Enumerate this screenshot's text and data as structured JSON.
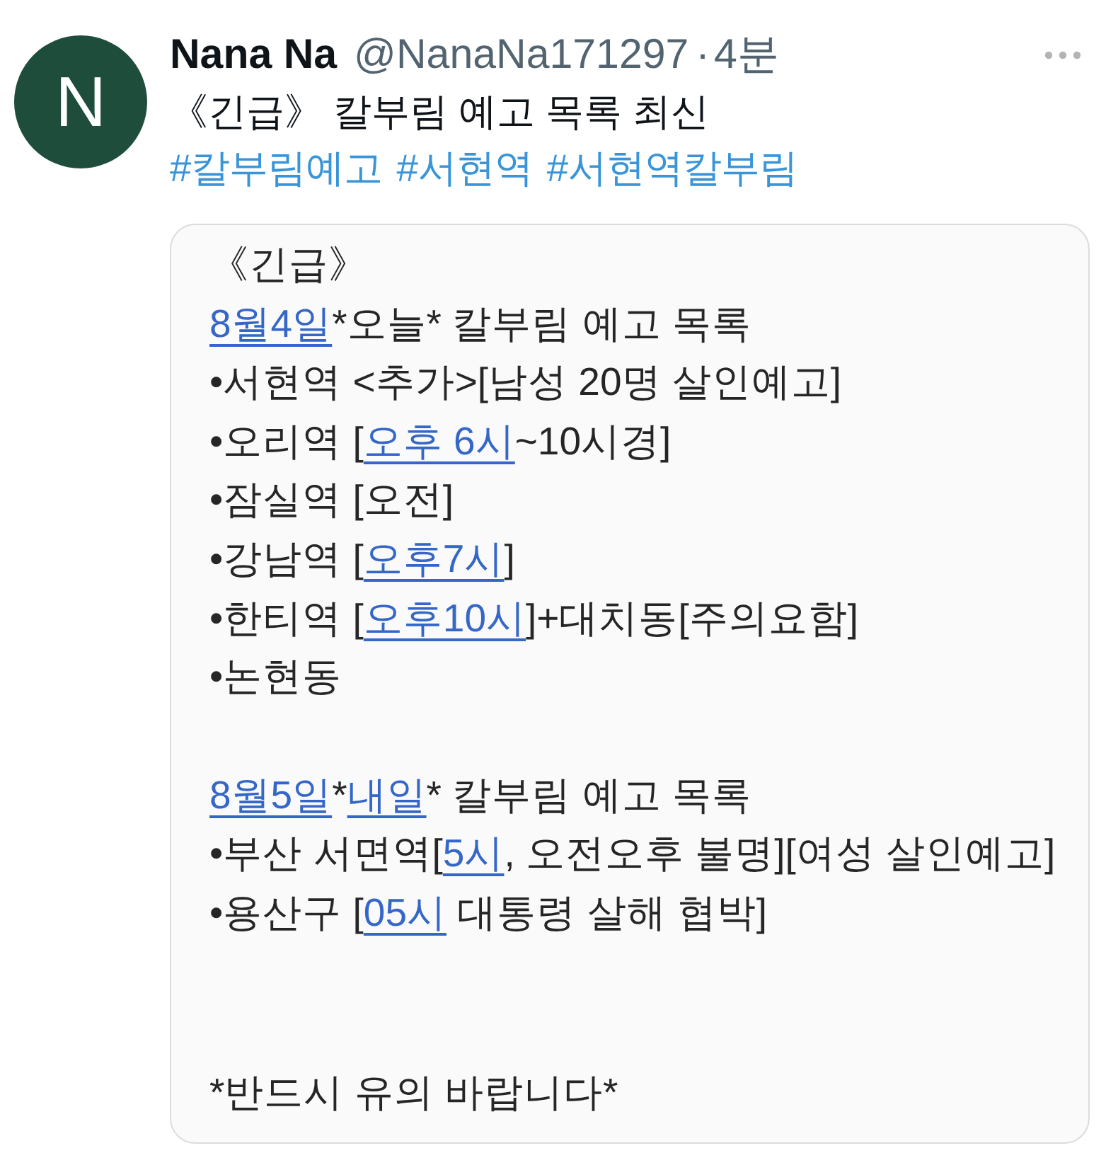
{
  "tweet": {
    "author": {
      "avatar_letter": "N",
      "name": "Nana Na",
      "handle": "@NanaNa171297",
      "separator": "·",
      "time": "4분"
    },
    "text": "《긴급》 칼부림 예고 목록 최신",
    "hashtags": [
      "#칼부림예고",
      "#서현역",
      "#서현역칼부림"
    ]
  },
  "note": {
    "sections": [
      {
        "lines": [
          [
            {
              "text": "《긴급》",
              "link": false
            }
          ],
          [
            {
              "text": "8월4일",
              "link": true
            },
            {
              "text": "*오늘* 칼부림 예고 목록",
              "link": false
            }
          ],
          [
            {
              "text": "•서현역 <추가>[남성 20명 살인예고]",
              "link": false
            }
          ],
          [
            {
              "text": "•오리역 [",
              "link": false
            },
            {
              "text": "오후 6시",
              "link": true
            },
            {
              "text": "~10시경]",
              "link": false
            }
          ],
          [
            {
              "text": "•잠실역 [오전]",
              "link": false
            }
          ],
          [
            {
              "text": "•강남역 [",
              "link": false
            },
            {
              "text": "오후7시",
              "link": true
            },
            {
              "text": "]",
              "link": false
            }
          ],
          [
            {
              "text": "•한티역 [",
              "link": false
            },
            {
              "text": "오후10시",
              "link": true
            },
            {
              "text": "]+대치동[주의요함]",
              "link": false
            }
          ],
          [
            {
              "text": "•논현동",
              "link": false
            }
          ]
        ]
      },
      {
        "lines": [
          [
            {
              "text": "8월5일",
              "link": true
            },
            {
              "text": "*",
              "link": false
            },
            {
              "text": "내일",
              "link": true
            },
            {
              "text": "* 칼부림 예고 목록",
              "link": false
            }
          ],
          [
            {
              "text": "•부산 서면역[",
              "link": false
            },
            {
              "text": "5시",
              "link": true
            },
            {
              "text": ", 오전오후 불명][여성 살인예고]",
              "link": false
            }
          ],
          [
            {
              "text": "•용산구 [",
              "link": false
            },
            {
              "text": "05시",
              "link": true
            },
            {
              "text": " 대통령 살해 협박]",
              "link": false
            }
          ]
        ]
      },
      {
        "lines": [
          [
            {
              "text": "*반드시 유의 바랍니다*",
              "link": false
            }
          ]
        ]
      }
    ]
  }
}
